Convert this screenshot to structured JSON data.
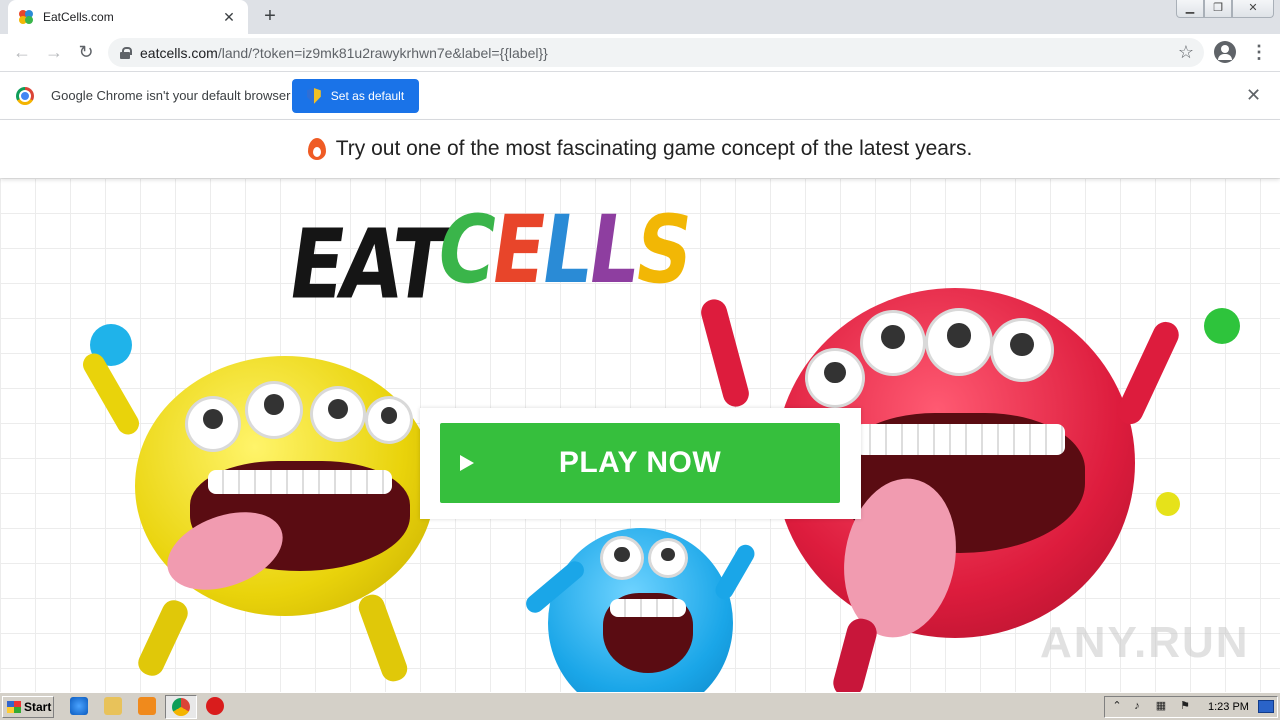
{
  "browser": {
    "tab_title": "EatCells.com",
    "url_host": "eatcells.com",
    "url_path": "/land/?token=iz9mk81u2rawykrhwn7e&label={{label}}",
    "new_tab_symbol": "+",
    "tab_close_symbol": "✕"
  },
  "infobar": {
    "message": "Google Chrome isn't your default browser",
    "button_label": "Set as default",
    "close_symbol": "✕"
  },
  "page": {
    "banner_text": "Try out one of the most fascinating game concept of the latest years.",
    "logo_word1": "EAT",
    "logo_word2_letters": [
      "C",
      "E",
      "L",
      "L",
      "S"
    ],
    "logo_word2_colors": [
      "#3ab54a",
      "#e8452a",
      "#2a8bd6",
      "#8e3ea0",
      "#f2b705"
    ],
    "play_button_label": "PLAY NOW",
    "accent_green": "#36bf3d",
    "watermark": "ANY.RUN"
  },
  "taskbar": {
    "start_label": "Start",
    "clock": "1:23 PM"
  },
  "icons": [
    "chrome-favicon",
    "back-icon",
    "forward-icon",
    "reload-icon",
    "lock-icon",
    "star-icon",
    "profile-icon",
    "menu-icon",
    "chrome-logo-icon",
    "shield-icon",
    "flame-icon",
    "play-icon"
  ]
}
